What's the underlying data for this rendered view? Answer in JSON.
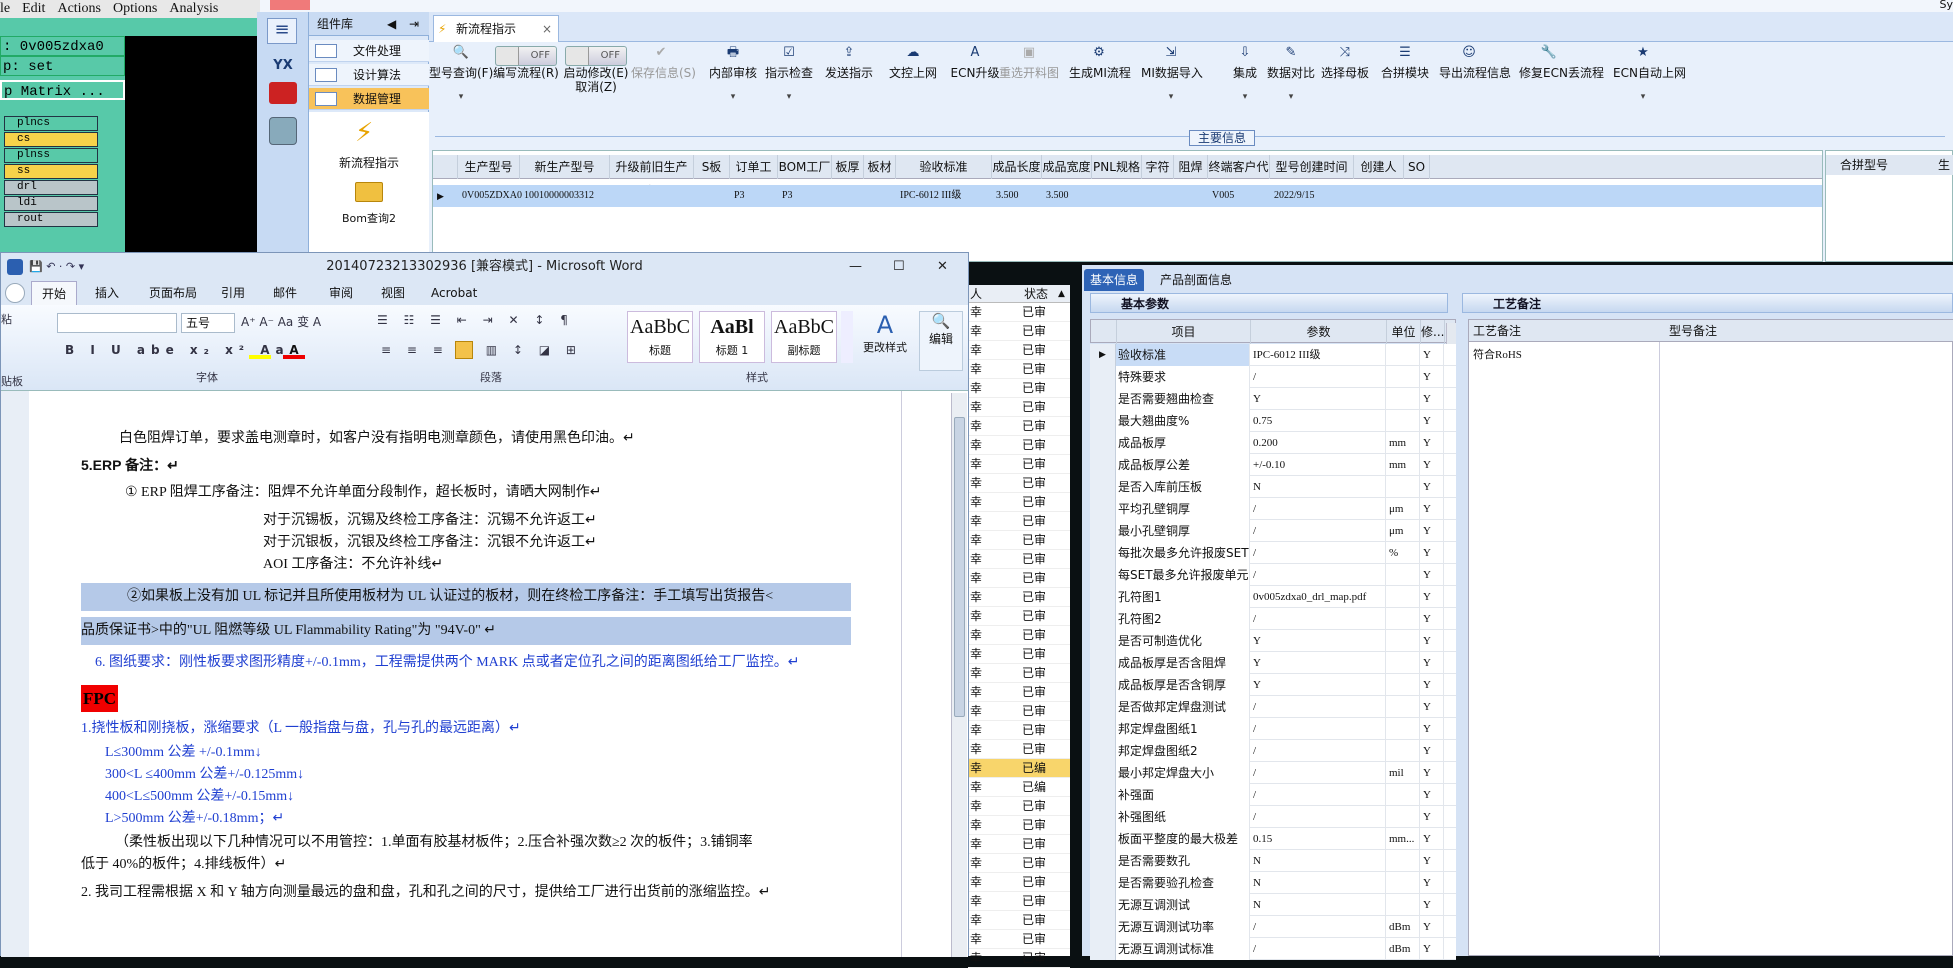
{
  "cam": {
    "menu": [
      "le",
      "Edit",
      "Actions",
      "Options",
      "Analysis"
    ],
    "line1": ": 0v005zdxa0",
    "line2": "p: set",
    "line3": "p Matrix ...",
    "layers": [
      {
        "name": "plncs",
        "color": "#58c9a8"
      },
      {
        "name": "cs",
        "color": "#f7d24a"
      },
      {
        "name": "plnss",
        "color": "#58c9a8"
      },
      {
        "name": "ss",
        "color": "#f7d24a"
      },
      {
        "name": "drl",
        "color": "#b9c5c9"
      },
      {
        "name": "ldi",
        "color": "#b9c5c9"
      },
      {
        "name": "rout",
        "color": "#b9c5c9"
      }
    ]
  },
  "erp": {
    "topbar_text": "Sy",
    "side_logo": "YX",
    "nav_title": "组件库",
    "nav_items": [
      "文件处理",
      "设计算法",
      "数据管理"
    ],
    "nav_actions": [
      "新流程指示",
      "Bom查询2"
    ],
    "tab_label": "新流程指示",
    "toolbar": [
      {
        "label": "型号查询(F)",
        "icon": "search-icon"
      },
      {
        "label": "编写流程(R)",
        "icon": "toggle",
        "toggle": "OFF"
      },
      {
        "label": "启动修改(E)",
        "sub": "取消(Z)",
        "icon": "toggle",
        "toggle": "OFF"
      },
      {
        "label": "保存信息(S)",
        "icon": "check-icon",
        "disabled": true
      },
      {
        "label": "内部审核",
        "icon": "printer-icon"
      },
      {
        "label": "指示检查",
        "icon": "checkbox-icon"
      },
      {
        "label": "发送指示",
        "icon": "upload-icon"
      },
      {
        "label": "文控上网",
        "icon": "cloud-icon"
      },
      {
        "label": "ECN升级",
        "icon": "font-icon"
      },
      {
        "label": "重选开料图",
        "icon": "image-icon",
        "disabled": true
      },
      {
        "label": "生成MI流程",
        "icon": "gears-icon"
      },
      {
        "label": "MI数据导入",
        "icon": "import-icon"
      },
      {
        "label": "集成",
        "icon": "download-icon"
      },
      {
        "label": "数据对比",
        "icon": "compare-icon"
      },
      {
        "label": "选择母板",
        "icon": "shuffle-icon"
      },
      {
        "label": "合拼模块",
        "icon": "list-icon"
      },
      {
        "label": "导出流程信息",
        "icon": "smile-icon"
      },
      {
        "label": "修复ECN丢流程",
        "icon": "wrench-icon"
      },
      {
        "label": "ECN自动上网",
        "icon": "star-icon"
      }
    ],
    "section_label": "主要信息",
    "grid_headers": [
      "生产型号",
      "新生产型号",
      "升级前旧生产型号",
      "S板",
      "订单工厂",
      "BOM工厂",
      "板厚",
      "板材",
      "验收标准",
      "成品长度",
      "成品宽度",
      "PNL规格",
      "字符",
      "阻焊",
      "终端客户代码",
      "型号创建时间",
      "创建人",
      "SO"
    ],
    "grid_row": [
      "0V005ZDXA0",
      "10010000003312",
      "",
      "",
      "P3",
      "P3",
      "",
      "",
      "IPC-6012 III级",
      "3.500",
      "3.500",
      "",
      "",
      "",
      "V005",
      "2022/9/15",
      "",
      ""
    ],
    "side_grid_headers": [
      "合拼型号",
      "生"
    ]
  },
  "list": {
    "headers": [
      "人",
      "状态"
    ],
    "col1": "幸",
    "rows": [
      "已审",
      "已审",
      "已审",
      "已审",
      "已审",
      "已审",
      "已审",
      "已审",
      "已审",
      "已审",
      "已审",
      "已审",
      "已审",
      "已审",
      "已审",
      "已审",
      "已审",
      "已审",
      "已审",
      "已审",
      "已审",
      "已审",
      "已审",
      "已审",
      "已编",
      "已编",
      "已审",
      "已审",
      "已审",
      "已审",
      "已审",
      "已审",
      "已审",
      "已审",
      "已审"
    ]
  },
  "panel": {
    "tabs": [
      "基本信息",
      "产品剖面信息"
    ],
    "group_title": "基本参数",
    "right_group_title": "工艺备注",
    "headers": [
      "项目",
      "参数",
      "单位",
      "修..."
    ],
    "right_headers": [
      "工艺备注",
      "型号备注"
    ],
    "right_value": "符合RoHS",
    "rows": [
      [
        "验收标准",
        "IPC-6012 III级",
        "",
        "Y"
      ],
      [
        "特殊要求",
        "/",
        "",
        "Y"
      ],
      [
        "是否需要翘曲检查",
        "Y",
        "",
        "Y"
      ],
      [
        "最大翘曲度%",
        "0.75",
        "",
        "Y"
      ],
      [
        "成品板厚",
        "0.200",
        "mm",
        "Y"
      ],
      [
        "成品板厚公差",
        "+/-0.10",
        "mm",
        "Y"
      ],
      [
        "是否入库前压板",
        "N",
        "",
        "Y"
      ],
      [
        "平均孔壁铜厚",
        "/",
        "μm",
        "Y"
      ],
      [
        "最小孔壁铜厚",
        "/",
        "μm",
        "Y"
      ],
      [
        "每批次最多允许报废SET",
        "/",
        "%",
        "Y"
      ],
      [
        "每SET最多允许报废单元",
        "/",
        "",
        "Y"
      ],
      [
        "孔符图1",
        "0v005zdxa0_drl_map.pdf",
        "",
        "Y"
      ],
      [
        "孔符图2",
        "/",
        "",
        "Y"
      ],
      [
        "是否可制造优化",
        "Y",
        "",
        "Y"
      ],
      [
        "成品板厚是否含阻焊",
        "Y",
        "",
        "Y"
      ],
      [
        "成品板厚是否含铜厚",
        "Y",
        "",
        "Y"
      ],
      [
        "是否做邦定焊盘测试",
        "/",
        "",
        "Y"
      ],
      [
        "邦定焊盘图纸1",
        "/",
        "",
        "Y"
      ],
      [
        "邦定焊盘图纸2",
        "/",
        "",
        "Y"
      ],
      [
        "最小邦定焊盘大小",
        "/",
        "mil",
        "Y"
      ],
      [
        "补强面",
        "/",
        "",
        "Y"
      ],
      [
        "补强图纸",
        "/",
        "",
        "Y"
      ],
      [
        "板面平整度的最大极差",
        "0.15",
        "mm...",
        "Y"
      ],
      [
        "是否需要数孔",
        "N",
        "",
        "Y"
      ],
      [
        "是否需要验孔检查",
        "N",
        "",
        "Y"
      ],
      [
        "无源互调测试",
        "N",
        "",
        "Y"
      ],
      [
        "无源互调测试功率",
        "/",
        "dBm",
        "Y"
      ],
      [
        "无源互调测试标准",
        "/",
        "dBm",
        "Y"
      ]
    ]
  },
  "word": {
    "title": "20140723213302936 [兼容模式] - Microsoft Word",
    "tabs": [
      "开始",
      "插入",
      "页面布局",
      "引用",
      "邮件",
      "审阅",
      "视图",
      "Acrobat"
    ],
    "font_size": "五号",
    "groups": [
      "字体",
      "段落",
      "样式",
      "编辑"
    ],
    "styles": [
      {
        "preview": "AaBbC",
        "label": "标题"
      },
      {
        "preview": "AaBl",
        "label": "标题 1"
      },
      {
        "preview": "AaBbC",
        "label": "副标题"
      }
    ],
    "change_style": "更改样式",
    "edit_label": "编辑",
    "clip_label": "粘",
    "clip_group": "贴板",
    "lines": [
      "白色阻焊订单，要求盖电测章时，如客户没有指明电测章颜色，请使用黑色印油。↵",
      "5.ERP 备注：↵",
      "① ERP 阻焊工序备注：阻焊不允许单面分段制作，超长板时，请晒大网制作↵",
      "对于沉锡板，沉锡及终检工序备注：沉锡不允许返工↵",
      "对于沉银板，沉银及终检工序备注：沉银不允许返工↵",
      "AOI 工序备注：不允许补线↵",
      "②如果板上没有加 UL 标记并且所使用板材为 UL 认证过的板材，则在终检工序备注：手工填写出货报告<",
      "品质保证书>中的\"UL 阻燃等级 UL Flammability Rating\"为 \"94V-0\" ↵",
      "6. 图纸要求：刚性板要求图形精度+/-0.1mm，工程需提供两个 MARK 点或者定位孔之间的距离图纸给工厂监控。↵",
      "FPC",
      "1.挠性板和刚挠板，涨缩要求（L 一般指盘与盘，孔与孔的最远距离）↵",
      "L≤300mm 公差 +/-0.1mm↓",
      "300<L ≤400mm 公差+/-0.125mm↓",
      "400<L≤500mm 公差+/-0.15mm↓",
      "L>500mm 公差+/-0.18mm；↵",
      "（柔性板出现以下几种情况可以不用管控：1.单面有胶基材板件；2.压合补强次数≥2 次的板件；3.铺铜率",
      "低于 40%的板件；4.排线板件）↵",
      "2.    我司工程需根据 X 和 Y 轴方向测量最远的盘和盘，孔和孔之间的尺寸，提供给工厂进行出货前的涨缩监控。↵"
    ]
  }
}
